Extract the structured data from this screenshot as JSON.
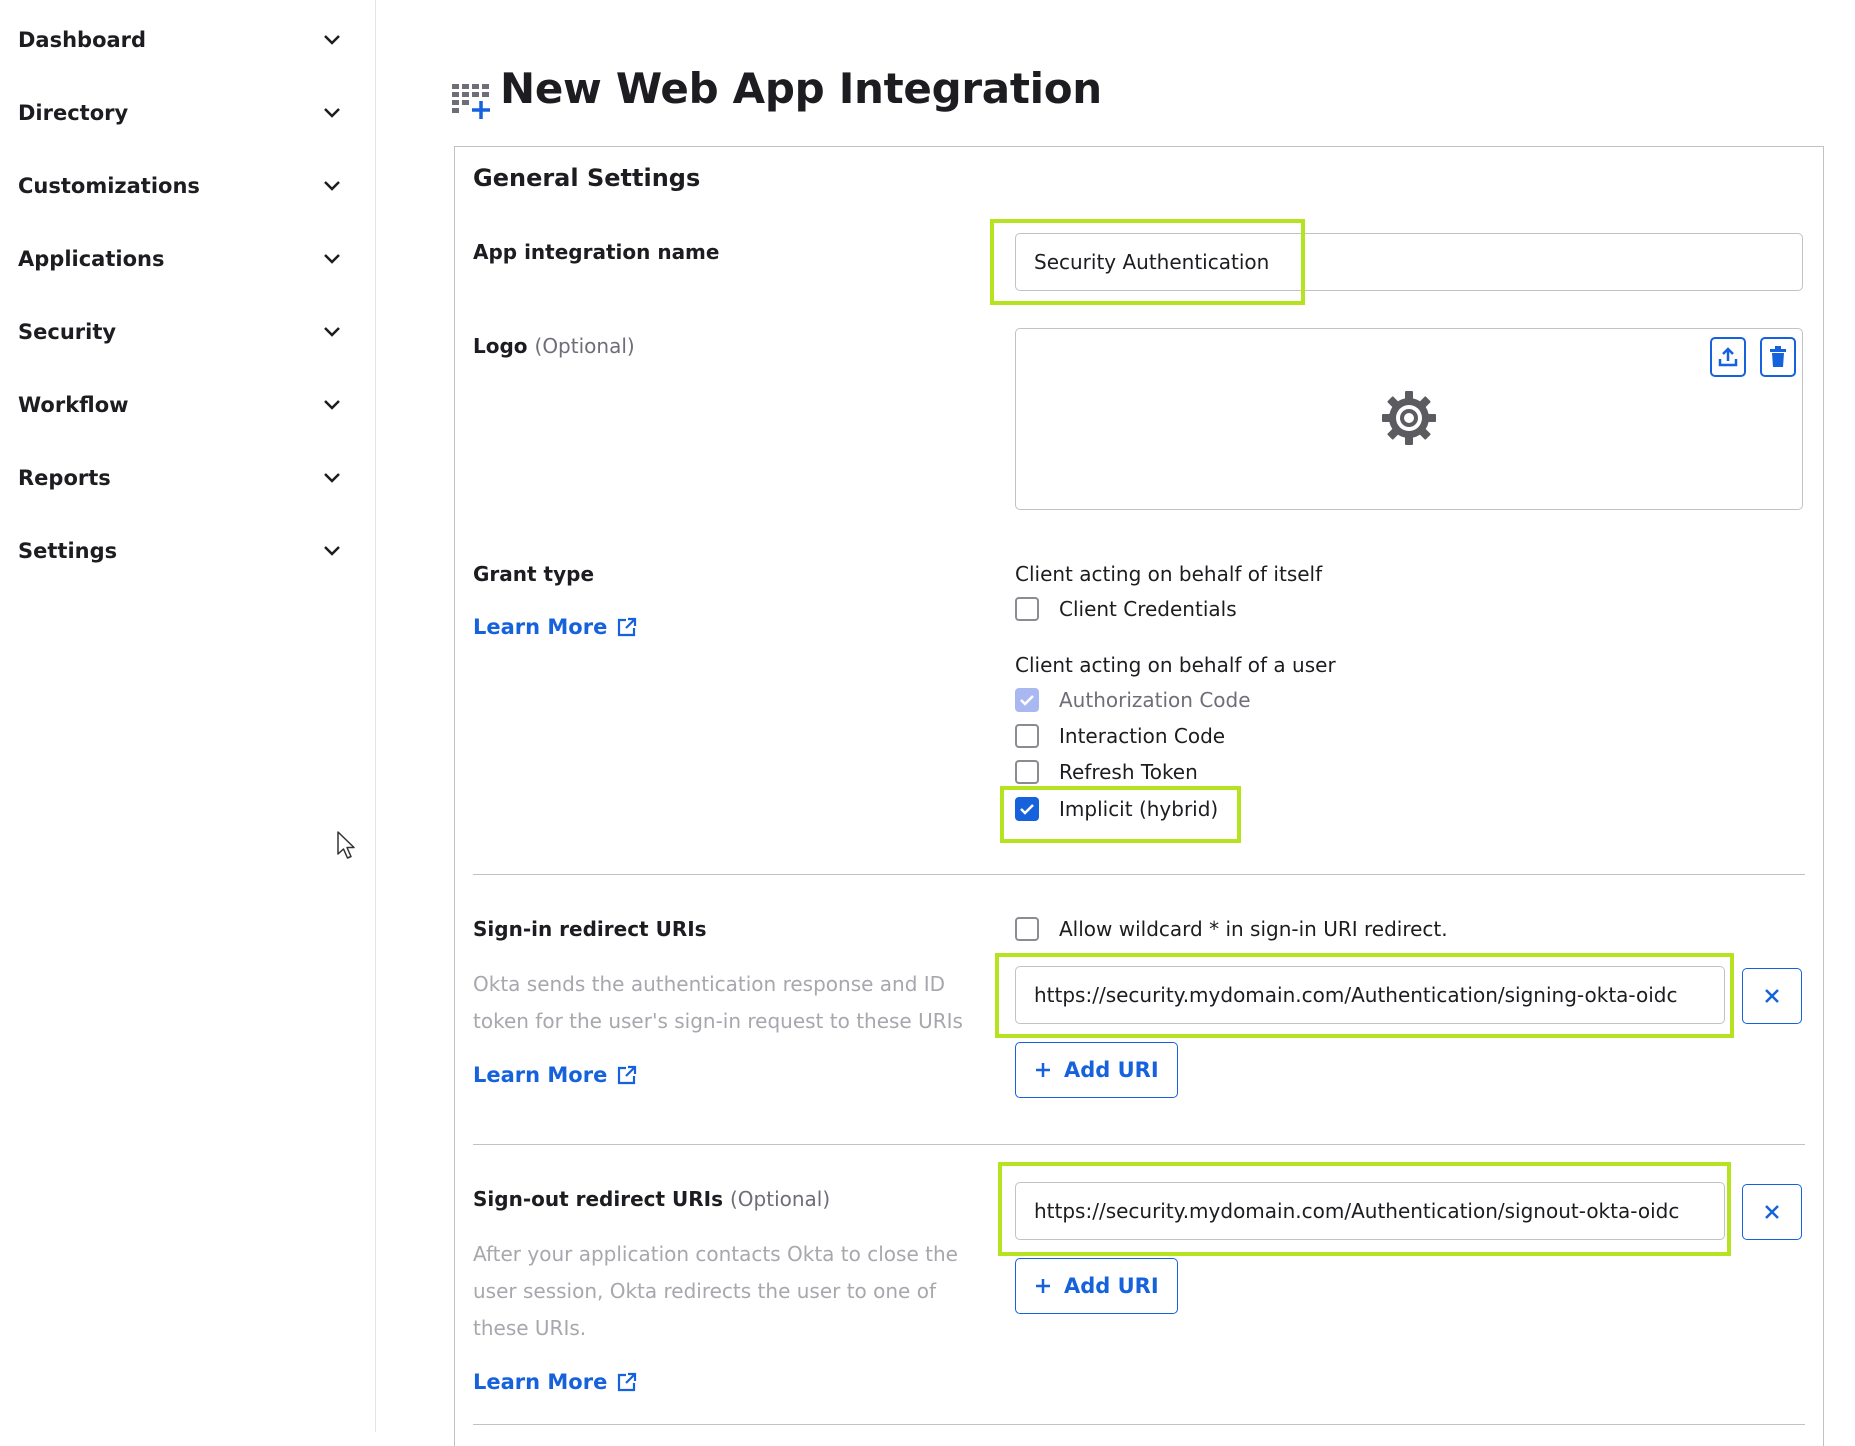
{
  "sidebar": {
    "items": [
      {
        "label": "Dashboard"
      },
      {
        "label": "Directory"
      },
      {
        "label": "Customizations"
      },
      {
        "label": "Applications"
      },
      {
        "label": "Security"
      },
      {
        "label": "Workflow"
      },
      {
        "label": "Reports"
      },
      {
        "label": "Settings"
      }
    ]
  },
  "page": {
    "title": "New Web App Integration",
    "section_title": "General Settings"
  },
  "app_name": {
    "label": "App integration name",
    "value": "Security Authentication"
  },
  "logo": {
    "label": "Logo",
    "optional": "(Optional)"
  },
  "grant_type": {
    "label": "Grant type",
    "learn_more": "Learn More",
    "group_self": "Client acting on behalf of itself",
    "client_credentials": "Client Credentials",
    "group_user": "Client acting on behalf of a user",
    "authorization_code": "Authorization Code",
    "interaction_code": "Interaction Code",
    "refresh_token": "Refresh Token",
    "implicit": "Implicit (hybrid)"
  },
  "signin": {
    "label": "Sign-in redirect URIs",
    "wildcard": "Allow wildcard * in sign-in URI redirect.",
    "desc": "Okta sends the authentication response and ID token for the user's sign-in request to these URIs",
    "learn_more": "Learn More",
    "uri": "https://security.mydomain.com/Authentication/signing-okta-oidc",
    "add_label": "Add URI"
  },
  "signout": {
    "label": "Sign-out redirect URIs",
    "optional": "(Optional)",
    "desc": "After your application contacts Okta to close the user session, Okta redirects the user to one of these URIs.",
    "learn_more": "Learn More",
    "uri": "https://security.mydomain.com/Authentication/signout-okta-oidc",
    "add_label": "Add URI"
  },
  "colors": {
    "accent": "#1662dd",
    "highlight": "#b6e31f",
    "text": "#1d1d21",
    "muted": "#a7a7ad"
  }
}
